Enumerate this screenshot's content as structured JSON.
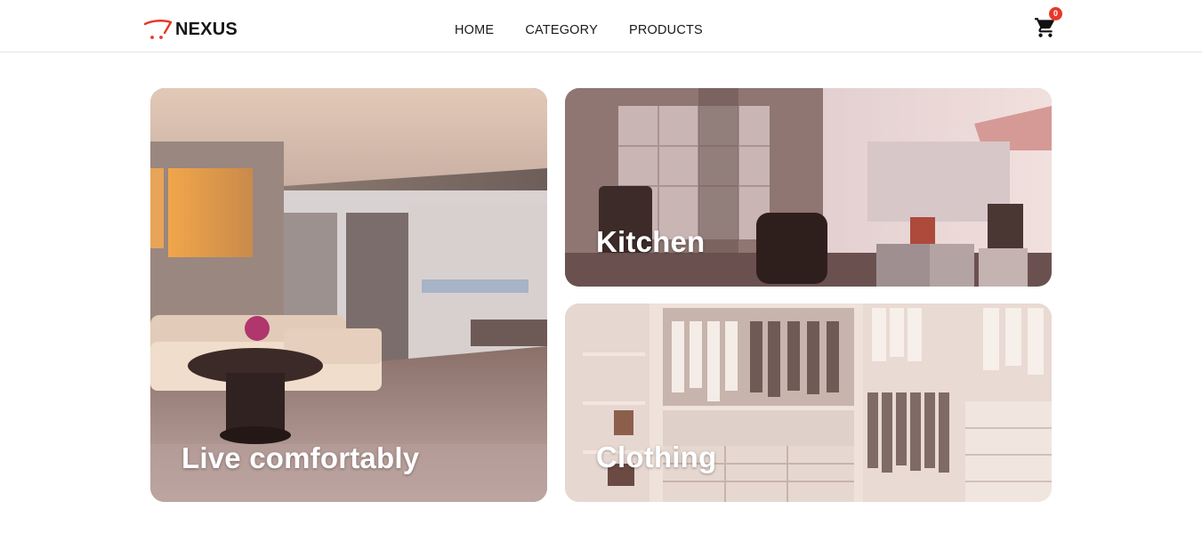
{
  "brand": {
    "name": "NEXUS",
    "logo_icon": "cart-swoosh-icon"
  },
  "nav": {
    "items": [
      {
        "label": "HOME"
      },
      {
        "label": "CATEGORY"
      },
      {
        "label": "PRODUCTS"
      }
    ]
  },
  "cart": {
    "icon": "shopping-cart-icon",
    "count": "0"
  },
  "tiles": [
    {
      "label": "Live comfortably"
    },
    {
      "label": "Kitchen"
    },
    {
      "label": "Clothing"
    }
  ],
  "colors": {
    "accent": "#e5382a",
    "text": "#1a1a1a",
    "border": "#e4e4e4"
  }
}
